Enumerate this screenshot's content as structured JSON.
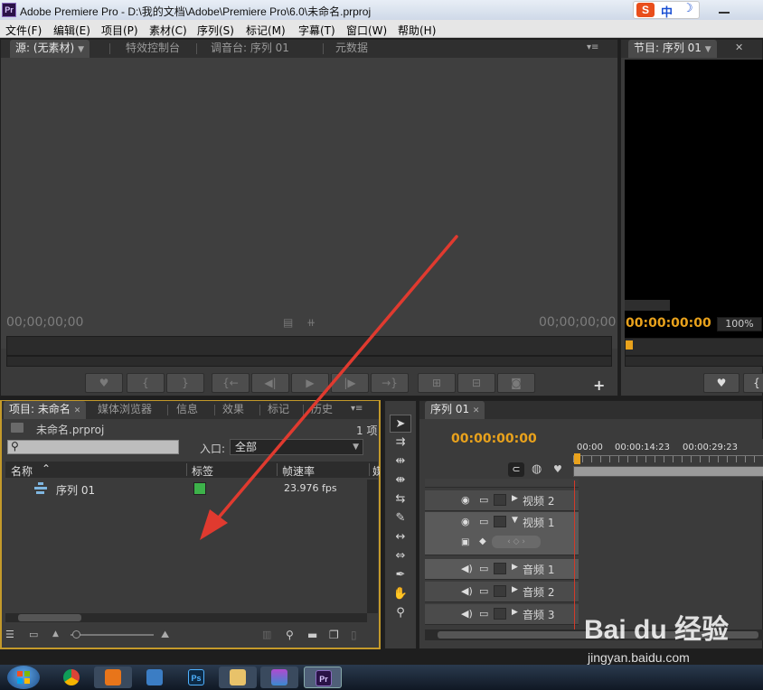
{
  "window": {
    "app_badge": "Pr",
    "title": "Adobe Premiere Pro - D:\\我的文档\\Adobe\\Premiere Pro\\6.0\\未命名.prproj"
  },
  "ime": {
    "logo": "S",
    "mode": "中",
    "moon": "☽"
  },
  "menu": [
    "文件(F)",
    "编辑(E)",
    "项目(P)",
    "素材(C)",
    "序列(S)",
    "标记(M)",
    "字幕(T)",
    "窗口(W)",
    "帮助(H)"
  ],
  "source_monitor": {
    "tabs": [
      "源: (无素材)",
      "特效控制台",
      "调音台: 序列 01",
      "元数据"
    ],
    "timecode_in": "00;00;00;00",
    "timecode_out": "00;00;00;00"
  },
  "program_monitor": {
    "tab": "节目: 序列 01",
    "timecode": "00:00:00:00",
    "zoom": "100%"
  },
  "project_panel": {
    "tabs": [
      "项目: 未命名",
      "媒体浏览器",
      "信息",
      "效果",
      "标记",
      "历史"
    ],
    "project_file": "未命名.prproj",
    "item_count": "1 项",
    "in_label": "入口:",
    "in_value": "全部",
    "columns": [
      "名称",
      "标签",
      "帧速率",
      "媒"
    ],
    "rows": [
      {
        "name": "序列 01",
        "label_color": "#3db24a",
        "fps": "23.976 fps"
      }
    ]
  },
  "timeline": {
    "tab": "序列 01",
    "timecode": "00:00:00:00",
    "ruler": [
      "00:00",
      "00:00:14:23",
      "00:00:29:23"
    ],
    "tracks": [
      {
        "name": "视频 2",
        "type": "video"
      },
      {
        "name": "视频 1",
        "type": "video"
      },
      {
        "name": "音频 1",
        "type": "audio"
      },
      {
        "name": "音频 2",
        "type": "audio"
      },
      {
        "name": "音频 3",
        "type": "audio"
      }
    ]
  },
  "watermark": {
    "brand": "Bai du 经验",
    "site": "jingyan.baidu.com"
  },
  "taskbar": {
    "ps_label": "Ps",
    "pr_label": "Pr"
  },
  "colors": {
    "accent_orange": "#e9a21c",
    "panel_focus": "#c49a2a",
    "arrow": "#e03a2f"
  }
}
